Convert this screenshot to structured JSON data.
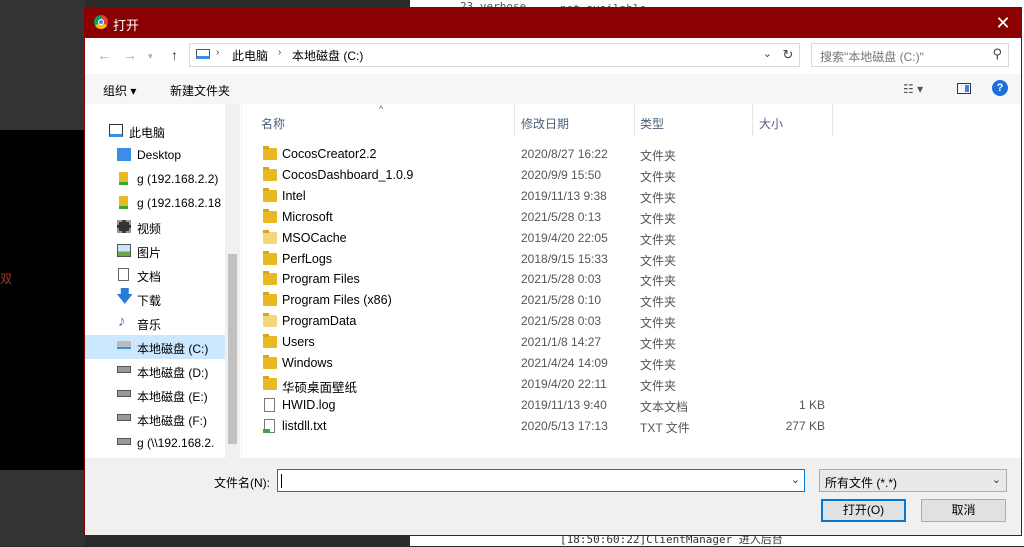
{
  "background": {
    "left_text": "双",
    "right_top_a": "23 verbose",
    "right_top_b": "not available",
    "right_bottom": "[18:50:60:22]ClientManager  进入后台"
  },
  "dialog": {
    "title": "打开",
    "close_glyph": "✕"
  },
  "nav": {
    "back": "←",
    "forward": "→",
    "up": "↑",
    "breadcrumb": [
      "此电脑",
      "本地磁盘 (C:)"
    ],
    "refresh": "↻",
    "search_placeholder": "搜索\"本地磁盘 (C:)\""
  },
  "toolbar": {
    "organize": "组织 ▾",
    "new_folder": "新建文件夹",
    "help": "?"
  },
  "sidebar": {
    "items": [
      {
        "label": "此电脑",
        "icon": "computer-icon"
      },
      {
        "label": "Desktop",
        "icon": "desktop-icon"
      },
      {
        "label": "g (192.168.2.2)",
        "icon": "network-drive-icon"
      },
      {
        "label": "g (192.168.2.18",
        "icon": "network-drive-icon"
      },
      {
        "label": "视频",
        "icon": "video-icon"
      },
      {
        "label": "图片",
        "icon": "pictures-icon"
      },
      {
        "label": "文档",
        "icon": "documents-icon"
      },
      {
        "label": "下载",
        "icon": "download-icon"
      },
      {
        "label": "音乐",
        "icon": "music-icon"
      },
      {
        "label": "本地磁盘 (C:)",
        "icon": "drive-c-icon",
        "selected": true
      },
      {
        "label": "本地磁盘 (D:)",
        "icon": "drive-icon"
      },
      {
        "label": "本地磁盘 (E:)",
        "icon": "drive-icon"
      },
      {
        "label": "本地磁盘 (F:)",
        "icon": "drive-icon"
      },
      {
        "label": "g (\\\\192.168.2.",
        "icon": "disconnected-drive-icon"
      }
    ]
  },
  "columns": {
    "name": "名称",
    "date": "修改日期",
    "type": "类型",
    "size": "大小"
  },
  "files": [
    {
      "name": "CocosCreator2.2",
      "date": "2020/8/27 16:22",
      "type": "文件夹",
      "size": "",
      "kind": "folder"
    },
    {
      "name": "CocosDashboard_1.0.9",
      "date": "2020/9/9 15:50",
      "type": "文件夹",
      "size": "",
      "kind": "folder"
    },
    {
      "name": "Intel",
      "date": "2019/11/13 9:38",
      "type": "文件夹",
      "size": "",
      "kind": "folder"
    },
    {
      "name": "Microsoft",
      "date": "2021/5/28 0:13",
      "type": "文件夹",
      "size": "",
      "kind": "folder"
    },
    {
      "name": "MSOCache",
      "date": "2019/4/20 22:05",
      "type": "文件夹",
      "size": "",
      "kind": "folder-light"
    },
    {
      "name": "PerfLogs",
      "date": "2018/9/15 15:33",
      "type": "文件夹",
      "size": "",
      "kind": "folder"
    },
    {
      "name": "Program Files",
      "date": "2021/5/28 0:03",
      "type": "文件夹",
      "size": "",
      "kind": "folder"
    },
    {
      "name": "Program Files (x86)",
      "date": "2021/5/28 0:10",
      "type": "文件夹",
      "size": "",
      "kind": "folder"
    },
    {
      "name": "ProgramData",
      "date": "2021/5/28 0:03",
      "type": "文件夹",
      "size": "",
      "kind": "folder-light"
    },
    {
      "name": "Users",
      "date": "2021/1/8 14:27",
      "type": "文件夹",
      "size": "",
      "kind": "folder"
    },
    {
      "name": "Windows",
      "date": "2021/4/24 14:09",
      "type": "文件夹",
      "size": "",
      "kind": "folder"
    },
    {
      "name": "华硕桌面壁纸",
      "date": "2019/4/20 22:11",
      "type": "文件夹",
      "size": "",
      "kind": "folder"
    },
    {
      "name": "HWID.log",
      "date": "2019/11/13 9:40",
      "type": "文本文档",
      "size": "1 KB",
      "kind": "text"
    },
    {
      "name": "listdll.txt",
      "date": "2020/5/13 17:13",
      "type": "TXT 文件",
      "size": "277 KB",
      "kind": "txt"
    }
  ],
  "footer": {
    "filename_label": "文件名(N):",
    "filename_value": "",
    "filetype": "所有文件 (*.*)",
    "open": "打开(O)",
    "cancel": "取消"
  }
}
